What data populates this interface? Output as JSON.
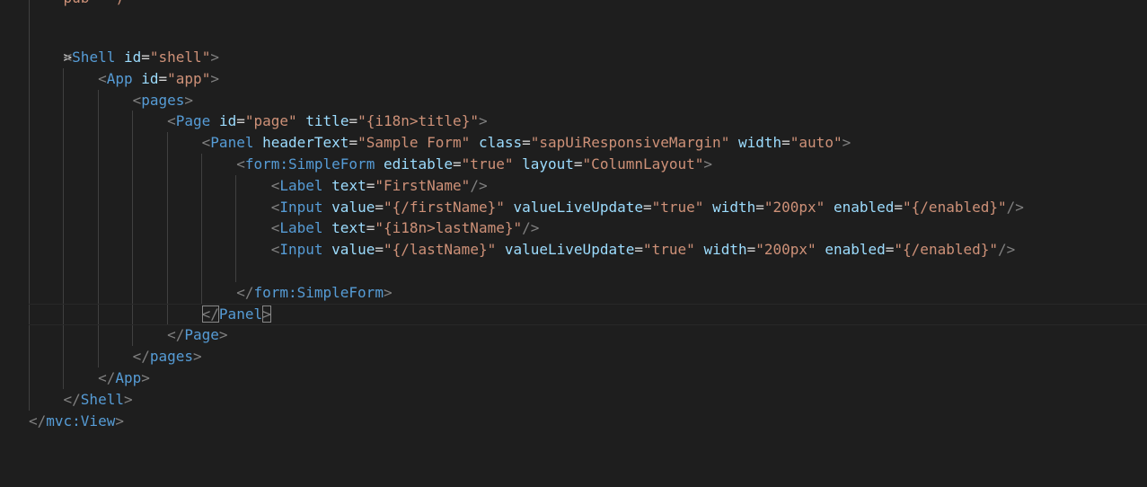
{
  "editor": {
    "theme": "dark",
    "background": "#1e1e1e",
    "colors": {
      "tag": "#569cd6",
      "attribute": "#9cdcfe",
      "string": "#ce9178",
      "punctuation": "#808080"
    },
    "fold_chevron": ">",
    "clipped_top_text": "    pub   )",
    "lines": [
      {
        "n": "shell-open",
        "tag": "Shell",
        "attrs": [
          {
            "k": "id",
            "v": "\"shell\""
          }
        ],
        "close": ">"
      },
      {
        "n": "app-open",
        "tag": "App",
        "attrs": [
          {
            "k": "id",
            "v": "\"app\""
          }
        ],
        "close": ">"
      },
      {
        "n": "pages-open",
        "tag": "pages",
        "close": ">"
      },
      {
        "n": "page-open",
        "tag": "Page",
        "attrs": [
          {
            "k": "id",
            "v": "\"page\""
          },
          {
            "k": "title",
            "v": "\"{i18n>title}\""
          }
        ],
        "close": ">"
      },
      {
        "n": "panel-open",
        "tag": "Panel",
        "attrs": [
          {
            "k": "headerText",
            "v": "\"Sample Form\""
          },
          {
            "k": "class",
            "v": "\"sapUiResponsiveMargin\""
          },
          {
            "k": "width",
            "v": "\"auto\""
          }
        ],
        "close": ">"
      },
      {
        "n": "form-open",
        "tag": "form:SimpleForm",
        "attrs": [
          {
            "k": "editable",
            "v": "\"true\""
          },
          {
            "k": "layout",
            "v": "\"ColumnLayout\""
          }
        ],
        "close": ">"
      },
      {
        "n": "label-1",
        "tag": "Label",
        "attrs": [
          {
            "k": "text",
            "v": "\"FirstName\""
          }
        ],
        "close": "/>"
      },
      {
        "n": "input-1",
        "tag": "Input",
        "attrs": [
          {
            "k": "value",
            "v": "\"{/firstName}\""
          },
          {
            "k": "valueLiveUpdate",
            "v": "\"true\""
          },
          {
            "k": "width",
            "v": "\"200px\""
          },
          {
            "k": "enabled",
            "v": "\"{/enabled}\""
          }
        ],
        "close": "/>"
      },
      {
        "n": "label-2",
        "tag": "Label",
        "attrs": [
          {
            "k": "text",
            "v": "\"{i18n>lastName}\""
          }
        ],
        "close": "/>"
      },
      {
        "n": "input-2",
        "tag": "Input",
        "attrs": [
          {
            "k": "value",
            "v": "\"{/lastName}\""
          },
          {
            "k": "valueLiveUpdate",
            "v": "\"true\""
          },
          {
            "k": "width",
            "v": "\"200px\""
          },
          {
            "k": "enabled",
            "v": "\"{/enabled}\""
          }
        ],
        "close": "/>"
      },
      {
        "n": "blank",
        "empty": true
      },
      {
        "n": "form-close",
        "closeTag": "form:SimpleForm"
      },
      {
        "n": "panel-close",
        "closeTag": "Panel",
        "current": true
      },
      {
        "n": "page-close",
        "closeTag": "Page"
      },
      {
        "n": "pages-close",
        "closeTag": "pages"
      },
      {
        "n": "app-close",
        "closeTag": "App"
      },
      {
        "n": "shell-close",
        "closeTag": "Shell"
      },
      {
        "n": "view-close",
        "closeTag": "mvc:View"
      }
    ]
  }
}
